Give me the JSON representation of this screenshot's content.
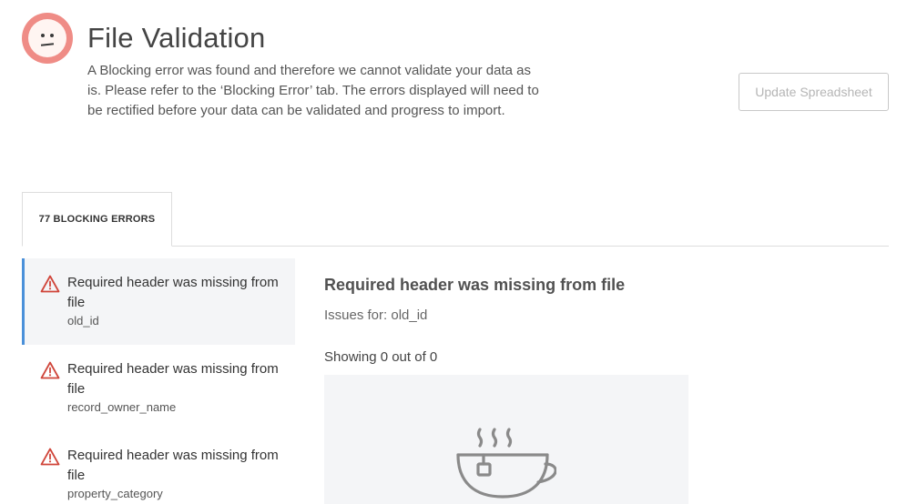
{
  "header": {
    "face_icon": "sad-face-icon",
    "title": "File Validation",
    "description": "A Blocking error was found and therefore we cannot validate your data as is. Please refer to the ‘Blocking Error’ tab. The errors displayed will need to be rectified before your data can be validated and progress to import.",
    "update_button": "Update Spreadsheet"
  },
  "tabs": [
    {
      "label": "77 BLOCKING ERRORS",
      "active": true
    }
  ],
  "errors": [
    {
      "title": "Required header was missing from file",
      "field": "old_id",
      "active": true
    },
    {
      "title": "Required header was missing from file",
      "field": "record_owner_name",
      "active": false
    },
    {
      "title": "Required header was missing from file",
      "field": "property_category",
      "active": false
    }
  ],
  "detail": {
    "title": "Required header was missing from file",
    "issues_for": "Issues for: old_id",
    "showing": "Showing 0 out of 0",
    "empty_icon": "teacup-icon"
  },
  "colors": {
    "face": "#ef8c86",
    "warning": "#d0453a",
    "active_border": "#4a90d9",
    "panel_bg": "#f4f5f7"
  }
}
